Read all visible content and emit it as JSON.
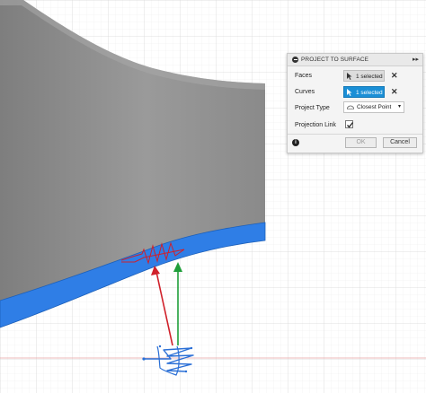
{
  "dialog": {
    "title": "PROJECT TO SURFACE",
    "rows": {
      "faces": {
        "label": "Faces",
        "value": "1 selected"
      },
      "curves": {
        "label": "Curves",
        "value": "1 selected"
      },
      "project_type": {
        "label": "Project Type",
        "value": "Closest Point"
      },
      "projection_link": {
        "label": "Projection Link",
        "checked": true
      }
    },
    "ok_label": "OK",
    "cancel_label": "Cancel",
    "clear_glyph": "✕",
    "expand_glyph": "▸▸",
    "dropdown_glyph": "▾",
    "info_glyph": "i"
  },
  "colors": {
    "surface_gray": "#8e8e8e",
    "selected_face_blue": "#2f7ee6",
    "active_button_blue": "#1a8fd6",
    "projected_curve_red": "#d0202a",
    "sketch_curve_blue": "#2a6fd6",
    "arrow_red": "#d0202a",
    "arrow_green": "#1f9e3a",
    "grid_line": "#e3e3e3",
    "axis_line_red": "#e8a0a0"
  },
  "icons": [
    "close-circle-icon",
    "expand-icon",
    "cursor-icon",
    "closest-point-icon",
    "checkmark-icon",
    "info-icon",
    "clear-icon"
  ]
}
